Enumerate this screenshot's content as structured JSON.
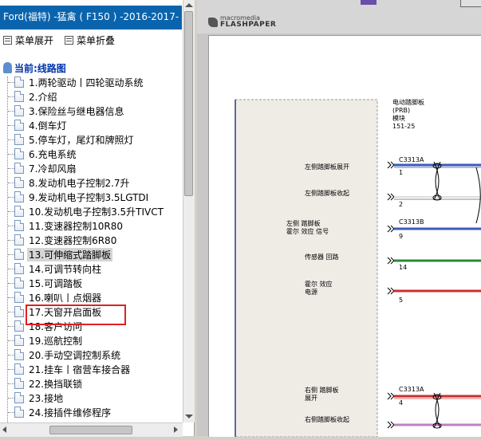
{
  "window": {
    "title": "Ford(福特) -猛禽 ( F150 ) -2016-2017- 线"
  },
  "toolbar": {
    "expand_label": "菜单展开",
    "collapse_label": "菜单折叠"
  },
  "tree": {
    "root_label": "当前:线路图",
    "items": [
      {
        "label": "1.两轮驱动丨四轮驱动系统"
      },
      {
        "label": "2.介绍"
      },
      {
        "label": "3.保险丝与继电器信息"
      },
      {
        "label": "4.倒车灯"
      },
      {
        "label": "5.停车灯，尾灯和牌照灯"
      },
      {
        "label": "6.充电系统"
      },
      {
        "label": "7.冷却风扇"
      },
      {
        "label": "8.发动机电子控制2.7升"
      },
      {
        "label": "9.发动机电子控制3.5LGTDI"
      },
      {
        "label": "10.发动机电子控制3.5升TIVCT"
      },
      {
        "label": "11.变速器控制10R80"
      },
      {
        "label": "12.变速器控制6R80"
      },
      {
        "label": "13.可伸缩式踏脚板"
      },
      {
        "label": "14.可调节转向柱"
      },
      {
        "label": "15.可调踏板"
      },
      {
        "label": "16.喇叭丨点烟器"
      },
      {
        "label": "17.天窗开启面板"
      },
      {
        "label": "18.客户访问"
      },
      {
        "label": "19.巡航控制"
      },
      {
        "label": "20.手动空调控制系统"
      },
      {
        "label": "21.挂车丨宿营车接合器"
      },
      {
        "label": "22.换挡联锁"
      },
      {
        "label": "23.接地"
      },
      {
        "label": "24.接插件维修程序"
      }
    ],
    "selected_index": 12
  },
  "viewer": {
    "brand_top": "macromedia",
    "brand_bottom": "FLASHPAPER"
  },
  "diagram": {
    "module_title": "电动踏脚板",
    "module_sub1": "(PRB)",
    "module_sub2": "模块",
    "module_code": "151-25",
    "signals": [
      {
        "label": "左侧踏脚板展开",
        "pin": "1"
      },
      {
        "label": "左侧踏脚板收起",
        "pin": "2"
      },
      {
        "label_line1": "左侧 踏脚板",
        "label_line2": "霍尔 效应 信号",
        "pin": "9"
      },
      {
        "label": "传感器 回路",
        "pin": "14"
      },
      {
        "label_line1": "霍尔 效应",
        "label_line2": "电源",
        "pin": "5"
      },
      {
        "label_line1": "右侧 踏脚板",
        "label_line2": "展开",
        "pin": "4"
      },
      {
        "label": "右侧踏脚板收起",
        "pin": ""
      }
    ],
    "connectors": [
      "C3313A",
      "C3313B",
      "C3313A"
    ]
  },
  "colors": {
    "title_bg": "#0a64ad",
    "selection_outline": "#e02020",
    "wire_blue": "#3b5bb8",
    "wire_green": "#2a8a3a",
    "wire_red": "#c83030"
  }
}
